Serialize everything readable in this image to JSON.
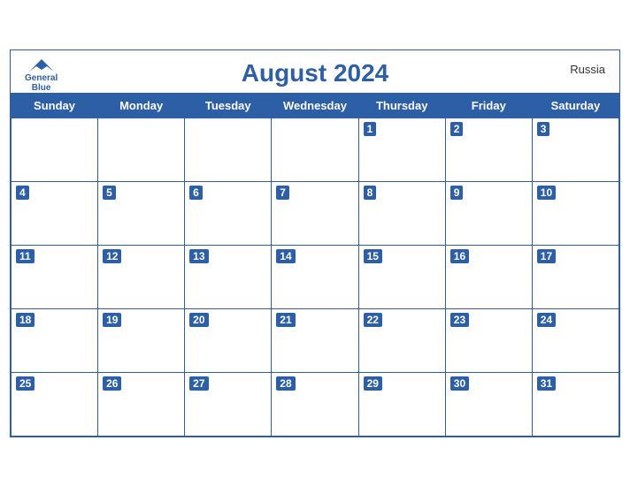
{
  "header": {
    "title": "August 2024",
    "country": "Russia",
    "logo_line1": "General",
    "logo_line2": "Blue"
  },
  "weekdays": [
    "Sunday",
    "Monday",
    "Tuesday",
    "Wednesday",
    "Thursday",
    "Friday",
    "Saturday"
  ],
  "weeks": [
    [
      null,
      null,
      null,
      null,
      1,
      2,
      3
    ],
    [
      4,
      5,
      6,
      7,
      8,
      9,
      10
    ],
    [
      11,
      12,
      13,
      14,
      15,
      16,
      17
    ],
    [
      18,
      19,
      20,
      21,
      22,
      23,
      24
    ],
    [
      25,
      26,
      27,
      28,
      29,
      30,
      31
    ]
  ]
}
